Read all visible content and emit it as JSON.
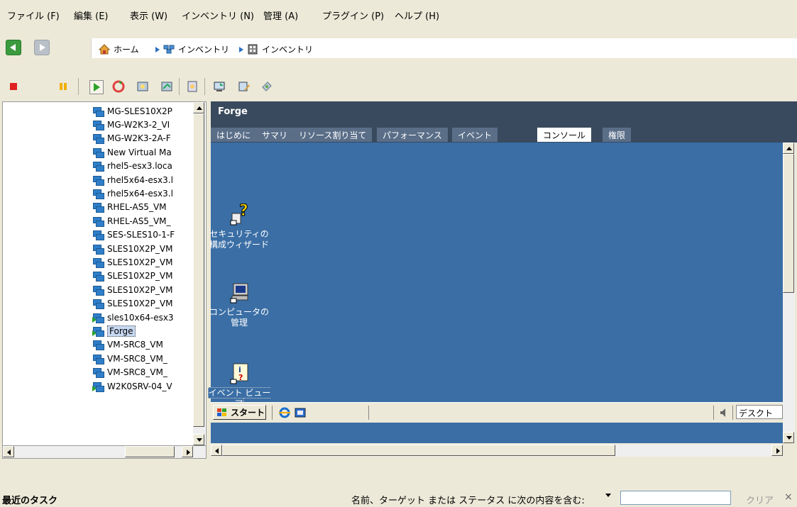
{
  "menu": [
    {
      "label": "ファイル (F)"
    },
    {
      "label": "編集 (E)"
    },
    {
      "label": "表示 (W)"
    },
    {
      "label": "インベントリ (N)"
    },
    {
      "label": "管理 (A)"
    },
    {
      "label": "プラグイン (P)"
    },
    {
      "label": "ヘルプ (H)"
    }
  ],
  "breadcrumb": [
    {
      "label": "ホーム"
    },
    {
      "label": "インベントリ"
    },
    {
      "label": "インベントリ"
    }
  ],
  "tree": {
    "items": [
      {
        "label": "MG-SLES10X2P"
      },
      {
        "label": "MG-W2K3-2_VI"
      },
      {
        "label": "MG-W2K3-2A-F"
      },
      {
        "label": "New Virtual Ma"
      },
      {
        "label": "rhel5-esx3.loca"
      },
      {
        "label": "rhel5x64-esx3.l"
      },
      {
        "label": "rhel5x64-esx3.l"
      },
      {
        "label": "RHEL-AS5_VM"
      },
      {
        "label": "RHEL-AS5_VM_"
      },
      {
        "label": "SES-SLES10-1-F"
      },
      {
        "label": "SLES10X2P_VM"
      },
      {
        "label": "SLES10X2P_VM"
      },
      {
        "label": "SLES10X2P_VM"
      },
      {
        "label": "SLES10X2P_VM"
      },
      {
        "label": "SLES10X2P_VM"
      },
      {
        "label": "sles10x64-esx3"
      },
      {
        "label": "Forge"
      },
      {
        "label": "VM-SRC8_VM"
      },
      {
        "label": "VM-SRC8_VM_"
      },
      {
        "label": "VM-SRC8_VM_"
      },
      {
        "label": "W2K0SRV-04_V"
      }
    ],
    "selected_index": 16
  },
  "panel": {
    "title": "Forge",
    "tabs": [
      {
        "label": "はじめに"
      },
      {
        "label": "サマリ"
      },
      {
        "label": "リソース割り当て"
      },
      {
        "label": "パフォーマンス"
      },
      {
        "label": "イベント"
      },
      {
        "label": "コンソール"
      },
      {
        "label": "権限"
      }
    ],
    "active_tab": "コンソール"
  },
  "console": {
    "icons": [
      {
        "label": "セキュリティの構成ウィザード",
        "icon": "security-wizard-icon"
      },
      {
        "label": "コンピュータの管理",
        "icon": "computer-management-icon"
      },
      {
        "label": "イベント ビューア",
        "icon": "event-viewer-icon"
      }
    ],
    "taskbar": {
      "start": "スタート",
      "tray_text": "デスクト"
    }
  },
  "bottom": {
    "title": "最近のタスク",
    "filter_label": "名前、ターゲット または ステータス に次の内容を含む:",
    "filter_value": "",
    "clear": "クリア",
    "close": "×"
  },
  "colors": {
    "console_bg": "#3a6ea5",
    "header_bg": "#3a4a5e",
    "accent": "#2b6fc2"
  }
}
